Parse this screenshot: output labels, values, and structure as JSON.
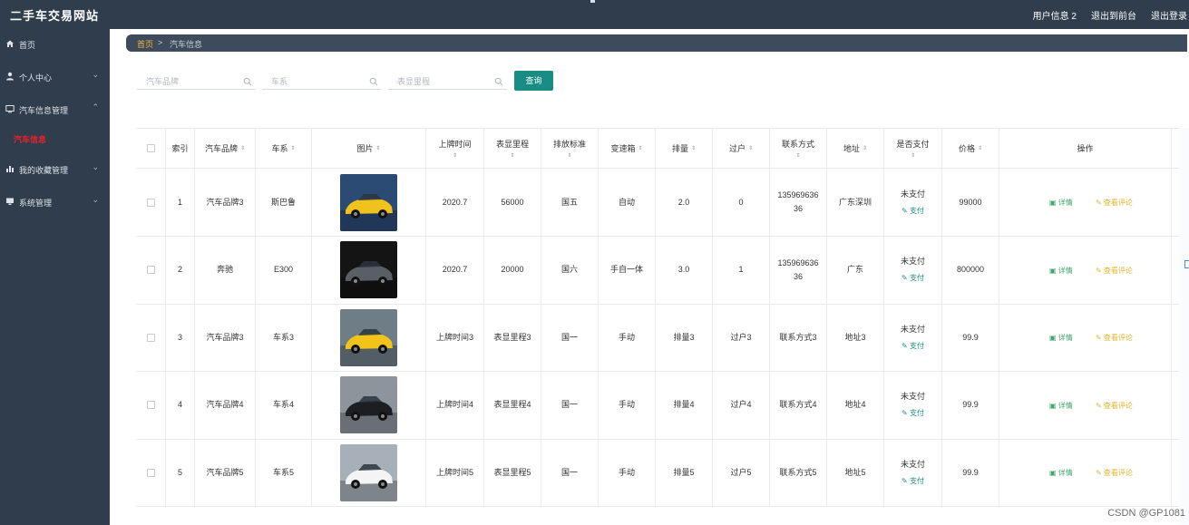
{
  "header": {
    "site_title": "二手车交易网站",
    "links": [
      "用户信息 2",
      "退出到前台",
      "退出登录"
    ]
  },
  "sidebar": {
    "items": [
      {
        "label": "首页",
        "icon": "home-icon",
        "arrow": ""
      },
      {
        "label": "个人中心",
        "icon": "user-icon",
        "arrow": "⌄"
      },
      {
        "label": "汽车信息管理",
        "icon": "monitor-icon",
        "arrow": "⌃"
      },
      {
        "label": "我的收藏管理",
        "icon": "bar-chart-icon",
        "arrow": "⌄"
      },
      {
        "label": "系统管理",
        "icon": "desktop-icon",
        "arrow": "⌄"
      }
    ],
    "active_sub": "汽车信息"
  },
  "breadcrumb": {
    "home": "首页",
    "sep": ">",
    "current": "汽车信息"
  },
  "search": {
    "brand_placeholder": "汽车品牌",
    "series_placeholder": "车系",
    "mileage_placeholder": "表显里程",
    "query_label": "查询"
  },
  "table": {
    "headers": {
      "index": "索引",
      "brand": "汽车品牌",
      "series": "车系",
      "image": "图片",
      "date": "上牌时间",
      "mileage": "表显里程",
      "emission": "排放标准",
      "gearbox": "变速箱",
      "displacement": "排量",
      "transfer": "过户",
      "contact": "联系方式",
      "address": "地址",
      "paid": "是否支付",
      "price": "价格",
      "action": "操作"
    },
    "sort_mark": "⇕",
    "rows": [
      {
        "index": "1",
        "brand": "汽车品牌3",
        "series": "斯巴鲁",
        "date": "2020.7",
        "mileage": "56000",
        "emission": "国五",
        "gearbox": "自动",
        "displacement": "2.0",
        "transfer": "0",
        "contact": "135969636 36",
        "address": "广东深圳",
        "paid": "未支付",
        "pay": "支付",
        "price": "99000",
        "detail": "详情",
        "comment": "查看评论",
        "car_color": "#f0c21b",
        "bg": "#2b4a74"
      },
      {
        "index": "2",
        "brand": "奔驰",
        "series": "E300",
        "date": "2020.7",
        "mileage": "20000",
        "emission": "国六",
        "gearbox": "手自一体",
        "displacement": "3.0",
        "transfer": "1",
        "contact": "135969636 36",
        "address": "广东",
        "paid": "未支付",
        "pay": "支付",
        "price": "800000",
        "detail": "详情",
        "comment": "查看评论",
        "car_color": "#5a5f66",
        "bg": "#141414"
      },
      {
        "index": "3",
        "brand": "汽车品牌3",
        "series": "车系3",
        "date": "上牌时间3",
        "mileage": "表显里程3",
        "emission": "国一",
        "gearbox": "手动",
        "displacement": "排量3",
        "transfer": "过户3",
        "contact": "联系方式3",
        "address": "地址3",
        "paid": "未支付",
        "pay": "支付",
        "price": "99.9",
        "detail": "详情",
        "comment": "查看评论",
        "car_color": "#f2c318",
        "bg": "#6f7d87"
      },
      {
        "index": "4",
        "brand": "汽车品牌4",
        "series": "车系4",
        "date": "上牌时间4",
        "mileage": "表显里程4",
        "emission": "国一",
        "gearbox": "手动",
        "displacement": "排量4",
        "transfer": "过户4",
        "contact": "联系方式4",
        "address": "地址4",
        "paid": "未支付",
        "pay": "支付",
        "price": "99.9",
        "detail": "详情",
        "comment": "查看评论",
        "car_color": "#1c1e22",
        "bg": "#8d949c"
      },
      {
        "index": "5",
        "brand": "汽车品牌5",
        "series": "车系5",
        "date": "上牌时间5",
        "mileage": "表显里程5",
        "emission": "国一",
        "gearbox": "手动",
        "displacement": "排量5",
        "transfer": "过户5",
        "contact": "联系方式5",
        "address": "地址5",
        "paid": "未支付",
        "pay": "支付",
        "price": "99.9",
        "detail": "详情",
        "comment": "查看评论",
        "car_color": "#f4f4f4",
        "bg": "#a7b0b8"
      }
    ]
  },
  "watermark": "CSDN @GP1081"
}
